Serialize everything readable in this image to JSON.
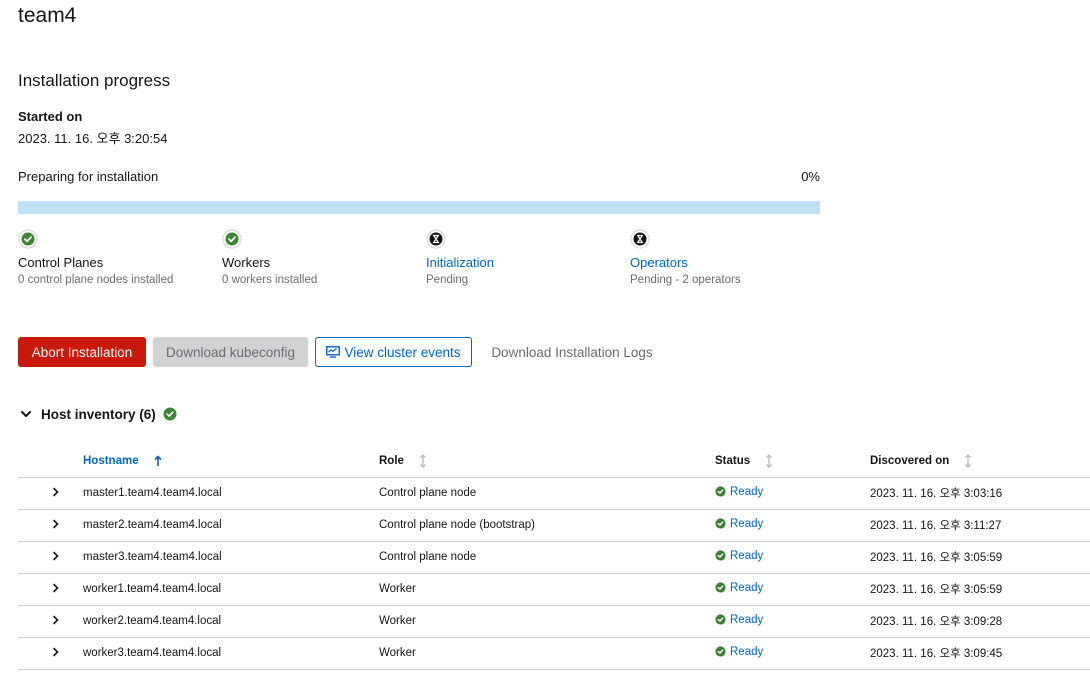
{
  "page": {
    "title": "team4"
  },
  "progress": {
    "title": "Installation progress",
    "started_label": "Started on",
    "started_value": "2023. 11. 16. 오후 3:20:54",
    "label": "Preparing for installation",
    "percent_text": "0%",
    "percent": 0
  },
  "stages": [
    {
      "title": "Control Planes",
      "sub": "0 control plane nodes installed",
      "state": "done",
      "icon": "check-circle-icon"
    },
    {
      "title": "Workers",
      "sub": "0 workers installed",
      "state": "done",
      "icon": "check-circle-icon"
    },
    {
      "title": "Initialization",
      "sub": "Pending",
      "state": "pending",
      "icon": "hourglass-icon"
    },
    {
      "title": "Operators",
      "sub": "Pending - 2 operators",
      "state": "pending",
      "icon": "hourglass-icon"
    }
  ],
  "actions": {
    "abort": "Abort Installation",
    "download_kubeconfig": "Download kubeconfig",
    "view_events": "View cluster events",
    "download_logs": "Download Installation Logs"
  },
  "inventory": {
    "title": "Host inventory (6)",
    "columns": {
      "hostname": "Hostname",
      "role": "Role",
      "status": "Status",
      "discovered": "Discovered on"
    },
    "rows": [
      {
        "hostname": "master1.team4.team4.local",
        "role": "Control plane node",
        "status": "Ready",
        "discovered": "2023. 11. 16. 오후 3:03:16"
      },
      {
        "hostname": "master2.team4.team4.local",
        "role": "Control plane node (bootstrap)",
        "status": "Ready",
        "discovered": "2023. 11. 16. 오후 3:11:27"
      },
      {
        "hostname": "master3.team4.team4.local",
        "role": "Control plane node",
        "status": "Ready",
        "discovered": "2023. 11. 16. 오후 3:05:59"
      },
      {
        "hostname": "worker1.team4.team4.local",
        "role": "Worker",
        "status": "Ready",
        "discovered": "2023. 11. 16. 오후 3:05:59"
      },
      {
        "hostname": "worker2.team4.team4.local",
        "role": "Worker",
        "status": "Ready",
        "discovered": "2023. 11. 16. 오후 3:09:28"
      },
      {
        "hostname": "worker3.team4.team4.local",
        "role": "Worker",
        "status": "Ready",
        "discovered": "2023. 11. 16. 오후 3:09:45"
      }
    ]
  },
  "colors": {
    "success": "#3e8635",
    "link": "#0066cc",
    "danger": "#c9190b",
    "progress_track": "#bee1f4"
  }
}
